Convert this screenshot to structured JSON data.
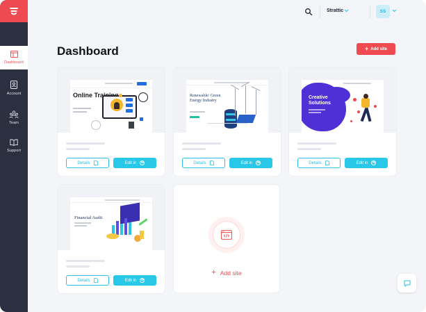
{
  "sidebar": {
    "items": [
      {
        "label": "Dashboard",
        "icon": "dashboard-icon",
        "active": true
      },
      {
        "label": "Account",
        "icon": "account-icon",
        "active": false
      },
      {
        "label": "Team",
        "icon": "team-icon",
        "active": false
      },
      {
        "label": "Support",
        "icon": "support-icon",
        "active": false
      }
    ]
  },
  "topbar": {
    "org_name": "Strattic",
    "avatar_initials": "SS"
  },
  "header": {
    "title": "Dashboard",
    "add_site_label": "Add site"
  },
  "cards": [
    {
      "thumb_heading": "Online Training",
      "details_label": "Details",
      "edit_label": "Edit in"
    },
    {
      "thumb_heading": "Renewable/ Green Energy Industry",
      "details_label": "Details",
      "edit_label": "Edit in"
    },
    {
      "thumb_heading": "Creative Solutions",
      "details_label": "Details",
      "edit_label": "Edit in"
    },
    {
      "thumb_heading": "Financial Audit",
      "details_label": "Details",
      "edit_label": "Edit in"
    }
  ],
  "add_card": {
    "label": "Add site"
  },
  "colors": {
    "accent": "#ef4a4f",
    "edit_button": "#29c8e8",
    "sidebar_bg": "#2b2f3f",
    "page_bg": "#f4f5f8"
  }
}
